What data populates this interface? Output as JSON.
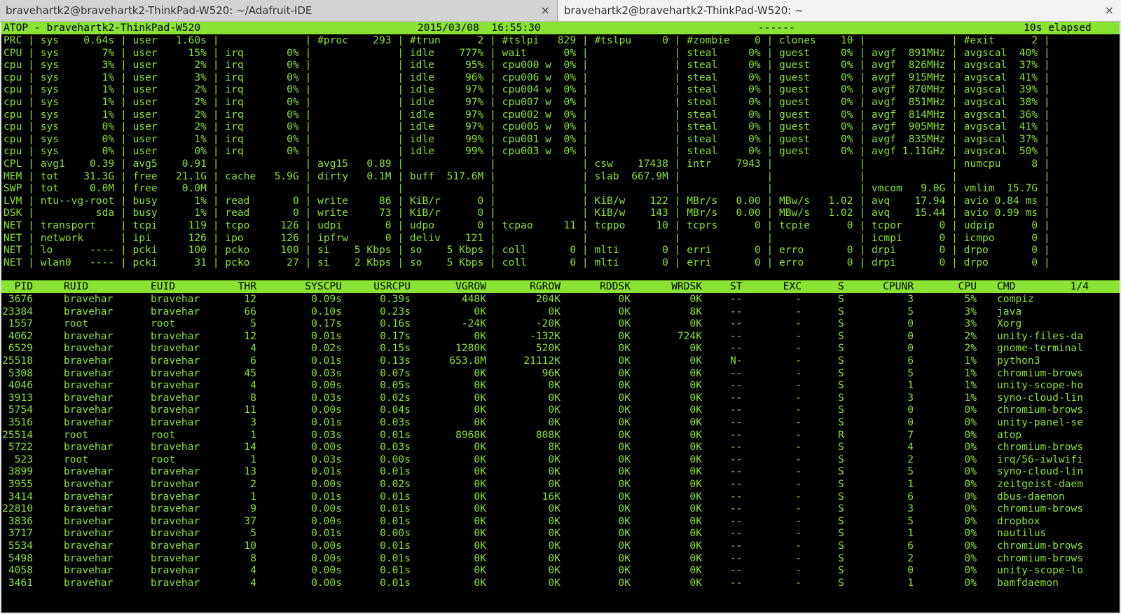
{
  "tabs": [
    {
      "title": "bravehartk2@bravehartk2-ThinkPad-W520: ~/Adafruit-IDE",
      "close": "×"
    },
    {
      "title": "bravehartk2@bravehartk2-ThinkPad-W520: ~",
      "close": "×"
    }
  ],
  "colors": {
    "fg": "#8ae234",
    "bg": "#000000",
    "bar": "#8ae234"
  },
  "header": {
    "host": "ATOP - bravehartk2-ThinkPad-W520",
    "date": "2015/03/08  16:55:30",
    "dashes": "------",
    "elapsed": "10s elapsed"
  },
  "sys_lines": [
    "PRC | sys    0.64s | user   1.60s |              | #proc    293 | #trun      2 | #tslpi   829 | #tslpu     0 | #zombie    0 | clones    10 |              | #exit      2 |",
    "CPU | sys       7% | user     15% | irq       0% |              | idle    777% | wait      0% |              | steal     0% | guest     0% | avgf  891MHz | avgscal  40% |",
    "cpu | sys       3% | user      2% | irq       0% |              | idle     95% | cpu000 w  0% |              | steal     0% | guest     0% | avgf  826MHz | avgscal  37% |",
    "cpu | sys       1% | user      3% | irq       0% |              | idle     96% | cpu006 w  0% |              | steal     0% | guest     0% | avgf  915MHz | avgscal  41% |",
    "cpu | sys       1% | user      2% | irq       0% |              | idle     97% | cpu004 w  0% |              | steal     0% | guest     0% | avgf  870MHz | avgscal  39% |",
    "cpu | sys       1% | user      2% | irq       0% |              | idle     97% | cpu007 w  0% |              | steal     0% | guest     0% | avgf  851MHz | avgscal  38% |",
    "cpu | sys       1% | user      2% | irq       0% |              | idle     97% | cpu002 w  0% |              | steal     0% | guest     0% | avgf  814MHz | avgscal  36% |",
    "cpu | sys       0% | user      2% | irq       0% |              | idle     97% | cpu005 w  0% |              | steal     0% | guest     0% | avgf  905MHz | avgscal  41% |",
    "cpu | sys       0% | user      1% | irq       0% |              | idle     99% | cpu001 w  0% |              | steal     0% | guest     0% | avgf  835MHz | avgscal  37% |",
    "cpu | sys       0% | user      0% | irq       0% |              | idle     99% | cpu003 w  0% |              | steal     0% | guest     0% | avgf 1.11GHz | avgscal  50% |",
    "CPL | avg1    0.39 | avg5    0.91 |              | avg15   0.89 |              |              | csw    17438 | intr    7943 |              |              | numcpu     8 |",
    "MEM | tot    31.3G | free   21.1G | cache   5.9G | dirty   0.1M | buff  517.6M |              | slab  667.9M |              |              |              |              |",
    "SWP | tot     0.0M | free    0.0M |              |              |              |              |              |              |              | vmcom   9.0G | vmlim  15.7G |",
    "LVM | ntu--vg-root | busy      1% | read       0 | write     86 | KiB/r      0 |              | KiB/w    122 | MBr/s   0.00 | MBw/s   1.02 | avq    17.94 | avio 0.84 ms |",
    "DSK |          sda | busy      1% | read       0 | write     73 | KiB/r      0 |              | KiB/w    143 | MBr/s   0.00 | MBw/s   1.02 | avq    15.44 | avio 0.99 ms |",
    "NET | transport    | tcpi     119 | tcpo     126 | udpi       0 | udpo       0 | tcpao     11 | tcppo     10 | tcprs      0 | tcpie      0 | tcpor      0 | udpip      0 |",
    "NET | network      | ipi      126 | ipo      126 | ipfrw      0 | deliv    121 |              |              |              |              | icmpi      0 | icmpo      0 |",
    "NET | lo      ---- | pcki     100 | pcko     100 | si    5 Kbps | so    5 Kbps | coll       0 | mlti       0 | erri       0 | erro       0 | drpi       0 | drpo       0 |",
    "NET | wlan0   ---- | pcki      31 | pcko      27 | si    2 Kbps | so    5 Kbps | coll       0 | mlti       0 | erri       0 | erro       0 | drpi       0 | drpo       0 |"
  ],
  "proc_header": [
    "PID",
    "RUID",
    "EUID",
    "THR",
    "SYSCPU",
    "USRCPU",
    "VGROW",
    "RGROW",
    "RDDSK",
    "WRDSK",
    "ST",
    "EXC",
    "S",
    "CPUNR",
    "CPU",
    "CMD",
    "1/4"
  ],
  "processes": [
    [
      "3676",
      "bravehar",
      "bravehar",
      "12",
      "0.09s",
      "0.39s",
      "448K",
      "204K",
      "0K",
      "0K",
      "--",
      "-",
      "S",
      "3",
      "5%",
      "compiz"
    ],
    [
      "23384",
      "bravehar",
      "bravehar",
      "66",
      "0.10s",
      "0.23s",
      "0K",
      "0K",
      "0K",
      "8K",
      "--",
      "-",
      "S",
      "5",
      "3%",
      "java"
    ],
    [
      "1557",
      "root",
      "root",
      "5",
      "0.17s",
      "0.16s",
      "-24K",
      "-20K",
      "0K",
      "0K",
      "--",
      "-",
      "S",
      "0",
      "3%",
      "Xorg"
    ],
    [
      "4062",
      "bravehar",
      "bravehar",
      "12",
      "0.01s",
      "0.17s",
      "0K",
      "-132K",
      "0K",
      "724K",
      "--",
      "-",
      "S",
      "0",
      "2%",
      "unity-files-da"
    ],
    [
      "6529",
      "bravehar",
      "bravehar",
      "4",
      "0.02s",
      "0.15s",
      "1280K",
      "520K",
      "0K",
      "0K",
      "--",
      "-",
      "S",
      "0",
      "2%",
      "gnome-terminal"
    ],
    [
      "25518",
      "bravehar",
      "bravehar",
      "6",
      "0.01s",
      "0.13s",
      "653.8M",
      "21112K",
      "0K",
      "0K",
      "N-",
      "-",
      "S",
      "6",
      "1%",
      "python3"
    ],
    [
      "5308",
      "bravehar",
      "bravehar",
      "45",
      "0.03s",
      "0.07s",
      "0K",
      "96K",
      "0K",
      "0K",
      "--",
      "-",
      "S",
      "5",
      "1%",
      "chromium-brows"
    ],
    [
      "4046",
      "bravehar",
      "bravehar",
      "4",
      "0.00s",
      "0.05s",
      "0K",
      "0K",
      "0K",
      "0K",
      "--",
      "-",
      "S",
      "1",
      "1%",
      "unity-scope-ho"
    ],
    [
      "3913",
      "bravehar",
      "bravehar",
      "8",
      "0.03s",
      "0.02s",
      "0K",
      "0K",
      "0K",
      "0K",
      "--",
      "-",
      "S",
      "3",
      "1%",
      "syno-cloud-lin"
    ],
    [
      "5754",
      "bravehar",
      "bravehar",
      "11",
      "0.00s",
      "0.04s",
      "0K",
      "0K",
      "0K",
      "0K",
      "--",
      "-",
      "S",
      "0",
      "0%",
      "chromium-brows"
    ],
    [
      "3516",
      "bravehar",
      "bravehar",
      "3",
      "0.01s",
      "0.03s",
      "0K",
      "0K",
      "0K",
      "0K",
      "--",
      "-",
      "S",
      "0",
      "0%",
      "unity-panel-se"
    ],
    [
      "25514",
      "root",
      "root",
      "1",
      "0.03s",
      "0.01s",
      "8968K",
      "808K",
      "0K",
      "0K",
      "--",
      "-",
      "R",
      "7",
      "0%",
      "atop"
    ],
    [
      "5722",
      "bravehar",
      "bravehar",
      "14",
      "0.00s",
      "0.03s",
      "0K",
      "8K",
      "0K",
      "0K",
      "--",
      "-",
      "S",
      "4",
      "0%",
      "chromium-brows"
    ],
    [
      "523",
      "root",
      "root",
      "1",
      "0.03s",
      "0.00s",
      "0K",
      "0K",
      "0K",
      "0K",
      "--",
      "-",
      "S",
      "2",
      "0%",
      "irq/56-iwlwifi"
    ],
    [
      "3899",
      "bravehar",
      "bravehar",
      "13",
      "0.01s",
      "0.01s",
      "0K",
      "0K",
      "0K",
      "0K",
      "--",
      "-",
      "S",
      "5",
      "0%",
      "syno-cloud-lin"
    ],
    [
      "3955",
      "bravehar",
      "bravehar",
      "2",
      "0.00s",
      "0.02s",
      "0K",
      "0K",
      "0K",
      "0K",
      "--",
      "-",
      "S",
      "1",
      "0%",
      "zeitgeist-daem"
    ],
    [
      "3414",
      "bravehar",
      "bravehar",
      "1",
      "0.01s",
      "0.01s",
      "0K",
      "16K",
      "0K",
      "0K",
      "--",
      "-",
      "S",
      "6",
      "0%",
      "dbus-daemon"
    ],
    [
      "22810",
      "bravehar",
      "bravehar",
      "9",
      "0.00s",
      "0.01s",
      "0K",
      "0K",
      "0K",
      "0K",
      "--",
      "-",
      "S",
      "3",
      "0%",
      "chromium-brows"
    ],
    [
      "3836",
      "bravehar",
      "bravehar",
      "37",
      "0.00s",
      "0.01s",
      "0K",
      "0K",
      "0K",
      "0K",
      "--",
      "-",
      "S",
      "5",
      "0%",
      "dropbox"
    ],
    [
      "3717",
      "bravehar",
      "bravehar",
      "5",
      "0.01s",
      "0.00s",
      "0K",
      "0K",
      "0K",
      "0K",
      "--",
      "-",
      "S",
      "1",
      "0%",
      "nautilus"
    ],
    [
      "5534",
      "bravehar",
      "bravehar",
      "10",
      "0.00s",
      "0.01s",
      "0K",
      "0K",
      "0K",
      "0K",
      "--",
      "-",
      "S",
      "6",
      "0%",
      "chromium-brows"
    ],
    [
      "5498",
      "bravehar",
      "bravehar",
      "8",
      "0.00s",
      "0.01s",
      "0K",
      "0K",
      "0K",
      "0K",
      "--",
      "-",
      "S",
      "2",
      "0%",
      "chromium-brows"
    ],
    [
      "4058",
      "bravehar",
      "bravehar",
      "4",
      "0.00s",
      "0.01s",
      "0K",
      "0K",
      "0K",
      "0K",
      "--",
      "-",
      "S",
      "0",
      "0%",
      "unity-scope-lo"
    ],
    [
      "3461",
      "bravehar",
      "bravehar",
      "4",
      "0.00s",
      "0.01s",
      "0K",
      "0K",
      "0K",
      "0K",
      "--",
      "-",
      "S",
      "1",
      "0%",
      "bamfdaemon"
    ]
  ]
}
